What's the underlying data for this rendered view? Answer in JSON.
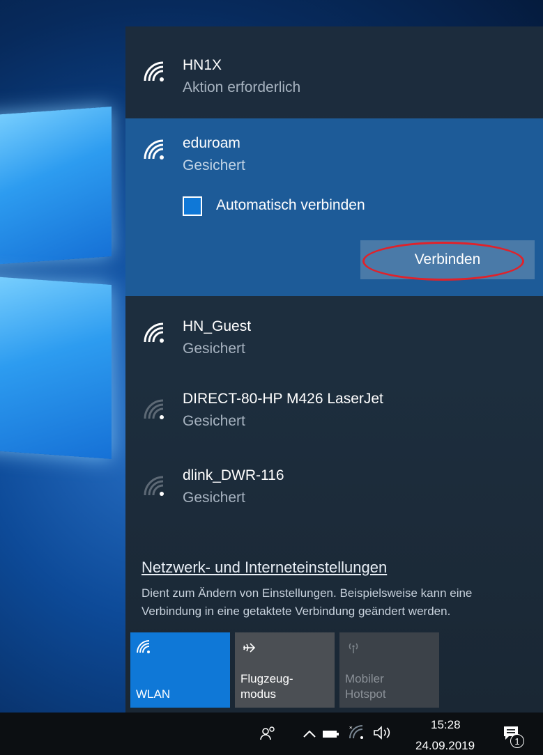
{
  "networks": [
    {
      "name": "HN1X",
      "status": "Aktion erforderlich",
      "signal": "full"
    },
    {
      "name": "eduroam",
      "status": "Gesichert",
      "signal": "full",
      "selected": true,
      "auto_connect_label": "Automatisch verbinden",
      "connect_label": "Verbinden"
    },
    {
      "name": "HN_Guest",
      "status": "Gesichert",
      "signal": "full"
    },
    {
      "name": "DIRECT-80-HP M426 LaserJet",
      "status": "Gesichert",
      "signal": "weak"
    },
    {
      "name": "dlink_DWR-116",
      "status": "Gesichert",
      "signal": "weak"
    }
  ],
  "settings": {
    "link": "Netzwerk- und Interneteinstellungen",
    "description": "Dient zum Ändern von Einstellungen. Beispielsweise kann eine Verbindung in eine getaktete Verbindung geändert werden."
  },
  "tiles": [
    {
      "label": "WLAN",
      "icon": "wifi-icon",
      "state": "on",
      "color": "#0f78d7"
    },
    {
      "label": "Flugzeug-\nmodus",
      "icon": "airplane-icon",
      "state": "off",
      "color": "#4b4f54"
    },
    {
      "label": "Mobiler\nHotspot",
      "icon": "hotspot-icon",
      "state": "disabled",
      "color": "#3c4249"
    }
  ],
  "taskbar": {
    "time": "15:28",
    "date": "24.09.2019",
    "notification_count": "1"
  },
  "colors": {
    "accent": "#0f78d7",
    "selected_row": "#1d5b98",
    "annotation": "#e0222a"
  }
}
